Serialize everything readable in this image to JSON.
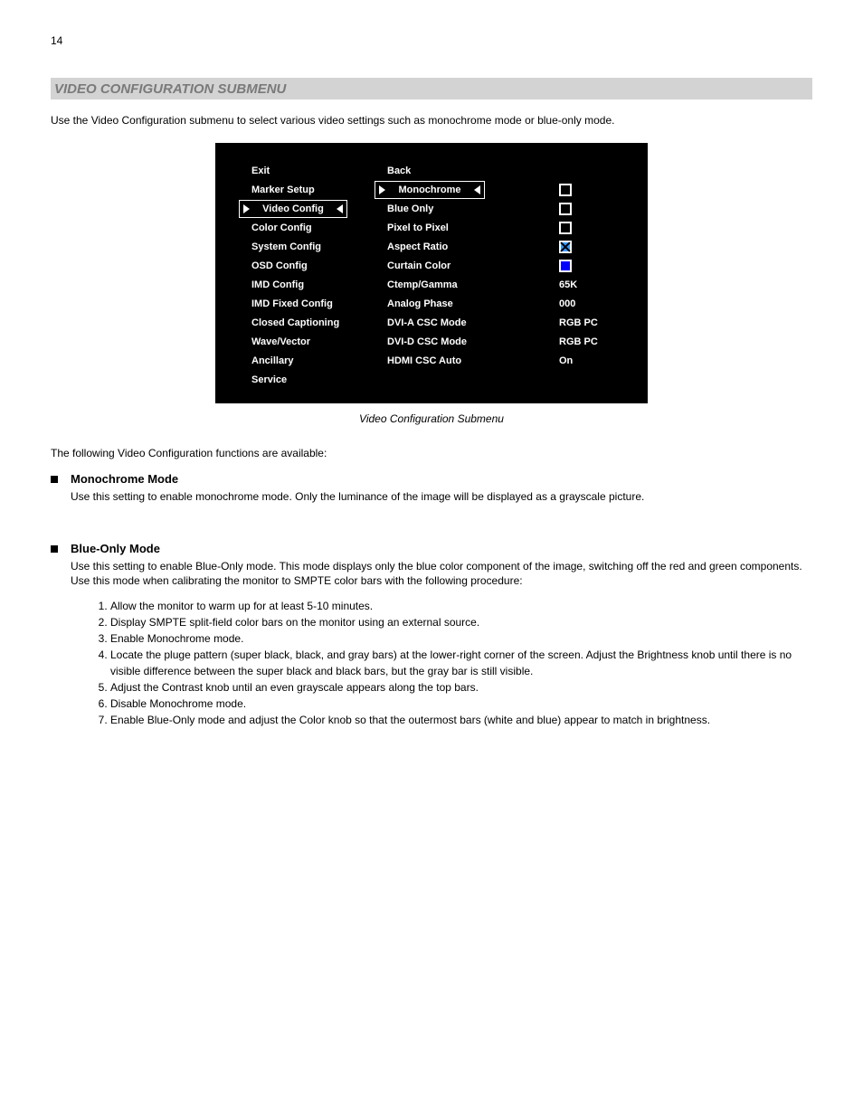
{
  "page_number": "14",
  "header_title": "VIDEO CONFIGURATION SUBMENU",
  "intro": "Use the Video Configuration submenu to select various video settings such as monochrome mode or blue-only mode.",
  "osd": {
    "left_items": [
      "Exit",
      "Marker Setup",
      "Video Config",
      "Color Config",
      "System Config",
      "OSD Config",
      "IMD Config",
      "IMD Fixed Config",
      "Closed Captioning",
      "Wave/Vector",
      "Ancillary",
      "Service"
    ],
    "left_selected_index": 2,
    "mid_items": [
      "Back",
      "Monochrome",
      "Blue Only",
      "Pixel to Pixel",
      "Aspect Ratio",
      "Curtain Color",
      "Ctemp/Gamma",
      "Analog Phase",
      "DVI-A CSC Mode",
      "DVI-D CSC Mode",
      "HDMI CSC Auto"
    ],
    "mid_selected_index": 1,
    "right_values": [
      "",
      "checkbox",
      "checkbox",
      "checkbox",
      "checkbox-checked",
      "swatch-blue",
      "65K",
      "000",
      "RGB PC",
      "RGB PC",
      "On"
    ]
  },
  "caption": "Video Configuration Submenu",
  "lead": "The following Video Configuration functions are available:",
  "items": [
    {
      "title": "Monochrome Mode",
      "body": "Use this setting to enable monochrome mode. Only the luminance of the image will be displayed as a grayscale picture."
    },
    {
      "title": "Blue-Only Mode",
      "body": "Use this setting to enable Blue-Only mode. This mode displays only the blue color component of the image, switching off the red and green components. Use this mode when calibrating the monitor to SMPTE color bars with the following procedure:"
    }
  ],
  "procedure": [
    "Allow the monitor to warm up for at least 5-10 minutes.",
    "Display SMPTE split-field color bars on the monitor using an external source.",
    "Enable Monochrome mode.",
    "Locate the pluge pattern (super black, black, and gray bars) at the lower-right corner of the screen. Adjust the Brightness knob until there is no visible difference between the super black and black bars, but the gray bar is still visible.",
    "Adjust the Contrast knob until an even grayscale appears along the top bars.",
    "Disable Monochrome mode.",
    "Enable Blue-Only mode and adjust the Color knob so that the outermost bars (white and blue) appear to match in brightness."
  ]
}
